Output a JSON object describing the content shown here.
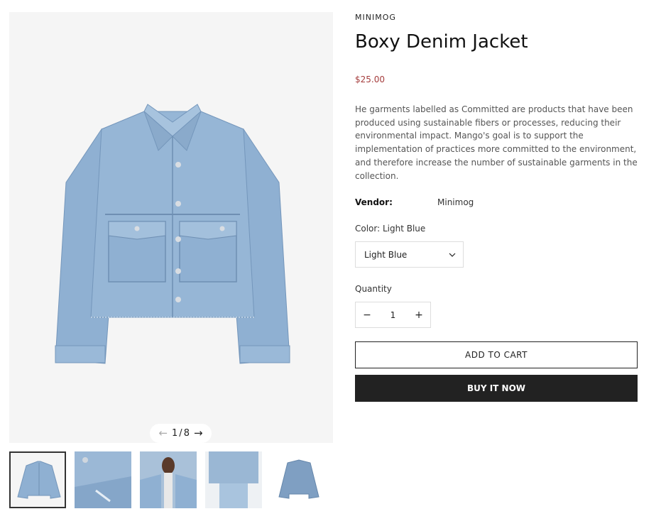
{
  "gallery": {
    "pager": {
      "current": "1",
      "separator": "/",
      "total": "8",
      "prev_icon": "arrow-left-icon",
      "next_icon": "arrow-right-icon"
    },
    "thumbnail_count": 5
  },
  "product": {
    "brand": "MINIMOG",
    "title": "Boxy Denim Jacket",
    "price": "$25.00",
    "price_color": "#a53d3d",
    "description": "He garments labelled as Committed are products that have been produced using sustainable fibers or processes, reducing their environmental impact. Mango's goal is to support the implementation of practices more committed to the environment, and therefore increase the number of sustainable garments in the collection.",
    "vendor_label": "Vendor:",
    "vendor_value": "Minimog",
    "color_label": "Color: Light Blue",
    "color_selected": "Light Blue",
    "quantity_label": "Quantity",
    "quantity_minus": "−",
    "quantity_value": "1",
    "quantity_plus": "+",
    "add_to_cart": "ADD TO CART",
    "buy_now": "BUY IT NOW"
  }
}
